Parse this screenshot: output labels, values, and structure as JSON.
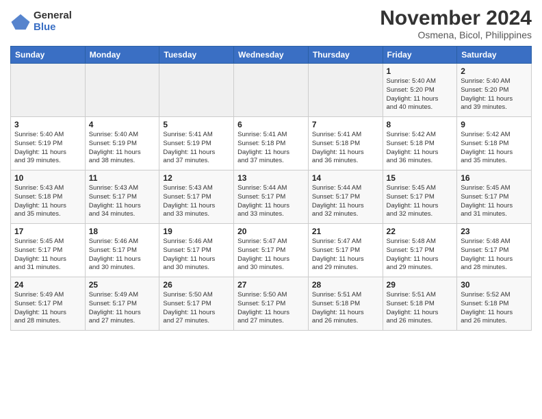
{
  "header": {
    "logo": {
      "general": "General",
      "blue": "Blue"
    },
    "title": "November 2024",
    "location": "Osmena, Bicol, Philippines"
  },
  "calendar": {
    "days_of_week": [
      "Sunday",
      "Monday",
      "Tuesday",
      "Wednesday",
      "Thursday",
      "Friday",
      "Saturday"
    ],
    "weeks": [
      {
        "days": [
          {
            "num": "",
            "info": ""
          },
          {
            "num": "",
            "info": ""
          },
          {
            "num": "",
            "info": ""
          },
          {
            "num": "",
            "info": ""
          },
          {
            "num": "",
            "info": ""
          },
          {
            "num": "1",
            "info": "Sunrise: 5:40 AM\nSunset: 5:20 PM\nDaylight: 11 hours\nand 40 minutes."
          },
          {
            "num": "2",
            "info": "Sunrise: 5:40 AM\nSunset: 5:20 PM\nDaylight: 11 hours\nand 39 minutes."
          }
        ]
      },
      {
        "days": [
          {
            "num": "3",
            "info": "Sunrise: 5:40 AM\nSunset: 5:19 PM\nDaylight: 11 hours\nand 39 minutes."
          },
          {
            "num": "4",
            "info": "Sunrise: 5:40 AM\nSunset: 5:19 PM\nDaylight: 11 hours\nand 38 minutes."
          },
          {
            "num": "5",
            "info": "Sunrise: 5:41 AM\nSunset: 5:19 PM\nDaylight: 11 hours\nand 37 minutes."
          },
          {
            "num": "6",
            "info": "Sunrise: 5:41 AM\nSunset: 5:18 PM\nDaylight: 11 hours\nand 37 minutes."
          },
          {
            "num": "7",
            "info": "Sunrise: 5:41 AM\nSunset: 5:18 PM\nDaylight: 11 hours\nand 36 minutes."
          },
          {
            "num": "8",
            "info": "Sunrise: 5:42 AM\nSunset: 5:18 PM\nDaylight: 11 hours\nand 36 minutes."
          },
          {
            "num": "9",
            "info": "Sunrise: 5:42 AM\nSunset: 5:18 PM\nDaylight: 11 hours\nand 35 minutes."
          }
        ]
      },
      {
        "days": [
          {
            "num": "10",
            "info": "Sunrise: 5:43 AM\nSunset: 5:18 PM\nDaylight: 11 hours\nand 35 minutes."
          },
          {
            "num": "11",
            "info": "Sunrise: 5:43 AM\nSunset: 5:17 PM\nDaylight: 11 hours\nand 34 minutes."
          },
          {
            "num": "12",
            "info": "Sunrise: 5:43 AM\nSunset: 5:17 PM\nDaylight: 11 hours\nand 33 minutes."
          },
          {
            "num": "13",
            "info": "Sunrise: 5:44 AM\nSunset: 5:17 PM\nDaylight: 11 hours\nand 33 minutes."
          },
          {
            "num": "14",
            "info": "Sunrise: 5:44 AM\nSunset: 5:17 PM\nDaylight: 11 hours\nand 32 minutes."
          },
          {
            "num": "15",
            "info": "Sunrise: 5:45 AM\nSunset: 5:17 PM\nDaylight: 11 hours\nand 32 minutes."
          },
          {
            "num": "16",
            "info": "Sunrise: 5:45 AM\nSunset: 5:17 PM\nDaylight: 11 hours\nand 31 minutes."
          }
        ]
      },
      {
        "days": [
          {
            "num": "17",
            "info": "Sunrise: 5:45 AM\nSunset: 5:17 PM\nDaylight: 11 hours\nand 31 minutes."
          },
          {
            "num": "18",
            "info": "Sunrise: 5:46 AM\nSunset: 5:17 PM\nDaylight: 11 hours\nand 30 minutes."
          },
          {
            "num": "19",
            "info": "Sunrise: 5:46 AM\nSunset: 5:17 PM\nDaylight: 11 hours\nand 30 minutes."
          },
          {
            "num": "20",
            "info": "Sunrise: 5:47 AM\nSunset: 5:17 PM\nDaylight: 11 hours\nand 30 minutes."
          },
          {
            "num": "21",
            "info": "Sunrise: 5:47 AM\nSunset: 5:17 PM\nDaylight: 11 hours\nand 29 minutes."
          },
          {
            "num": "22",
            "info": "Sunrise: 5:48 AM\nSunset: 5:17 PM\nDaylight: 11 hours\nand 29 minutes."
          },
          {
            "num": "23",
            "info": "Sunrise: 5:48 AM\nSunset: 5:17 PM\nDaylight: 11 hours\nand 28 minutes."
          }
        ]
      },
      {
        "days": [
          {
            "num": "24",
            "info": "Sunrise: 5:49 AM\nSunset: 5:17 PM\nDaylight: 11 hours\nand 28 minutes."
          },
          {
            "num": "25",
            "info": "Sunrise: 5:49 AM\nSunset: 5:17 PM\nDaylight: 11 hours\nand 27 minutes."
          },
          {
            "num": "26",
            "info": "Sunrise: 5:50 AM\nSunset: 5:17 PM\nDaylight: 11 hours\nand 27 minutes."
          },
          {
            "num": "27",
            "info": "Sunrise: 5:50 AM\nSunset: 5:17 PM\nDaylight: 11 hours\nand 27 minutes."
          },
          {
            "num": "28",
            "info": "Sunrise: 5:51 AM\nSunset: 5:18 PM\nDaylight: 11 hours\nand 26 minutes."
          },
          {
            "num": "29",
            "info": "Sunrise: 5:51 AM\nSunset: 5:18 PM\nDaylight: 11 hours\nand 26 minutes."
          },
          {
            "num": "30",
            "info": "Sunrise: 5:52 AM\nSunset: 5:18 PM\nDaylight: 11 hours\nand 26 minutes."
          }
        ]
      }
    ]
  }
}
